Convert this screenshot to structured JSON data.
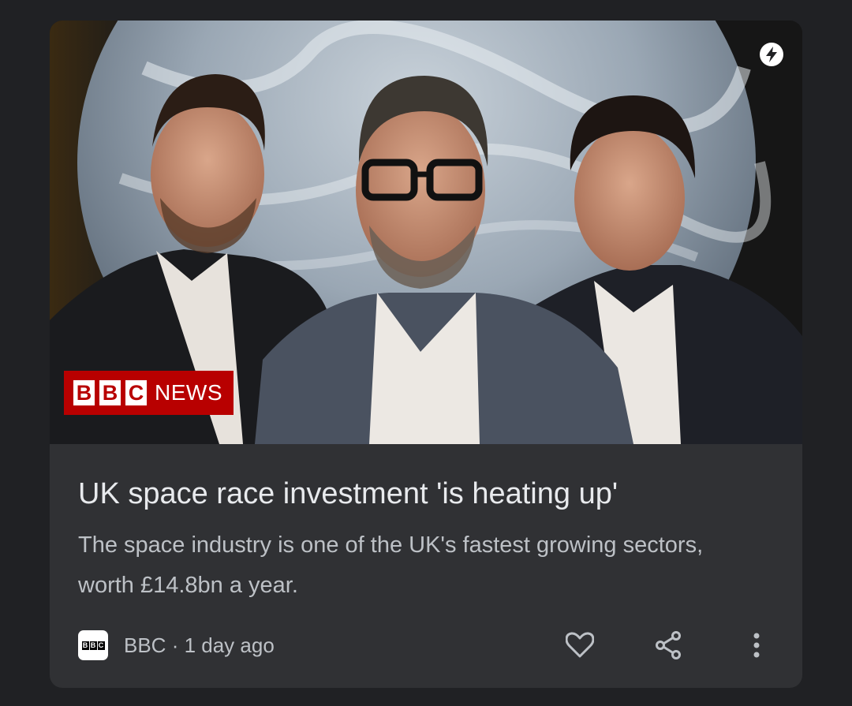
{
  "card": {
    "image_alt": "Three men standing in front of a large illuminated Earth globe",
    "image_watermark": {
      "logo_letters": [
        "B",
        "B",
        "C"
      ],
      "logo_word": "NEWS"
    },
    "headline": "UK space race investment 'is heating up'",
    "snippet": "The space industry is one of the UK's fastest growing sectors, worth £14.8bn a year.",
    "source": {
      "name": "BBC",
      "separator": " · ",
      "time": "1 day ago",
      "logo_letters": [
        "B",
        "B",
        "C"
      ]
    },
    "actions": {
      "like_icon": "heart-outline-icon",
      "share_icon": "share-icon",
      "more_icon": "more-vert-icon"
    },
    "badge_icon": "amp-lightning-icon"
  },
  "colors": {
    "background": "#202124",
    "card": "#303134",
    "headline": "#e8eaed",
    "secondary_text": "#bdc1c6",
    "bbc_red": "#b80000"
  }
}
